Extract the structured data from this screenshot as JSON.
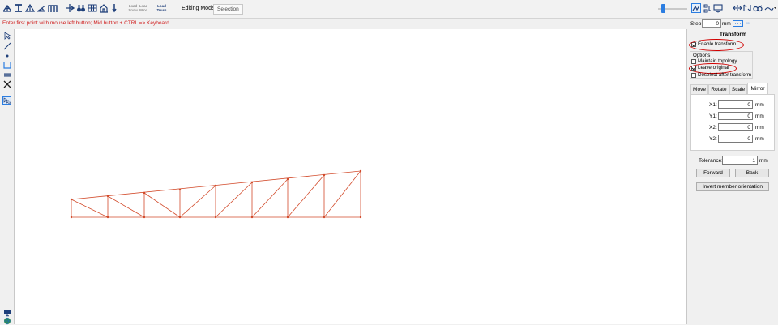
{
  "toolbar": {
    "tool_icons": [
      "truss-tool-icon",
      "i-beam-tool-icon",
      "triangle-tool-icon",
      "fan-truss-tool-icon",
      "portal-frame-tool-icon",
      "node-arrow-tool-icon",
      "binoculars-tool-icon",
      "grid-tool-icon",
      "building-tool-icon",
      "load-arrow-tool-icon"
    ],
    "load_buttons": [
      {
        "line1": "Load",
        "line2": "Snow"
      },
      {
        "line1": "Load",
        "line2": "Wind"
      },
      {
        "line1": "Load",
        "line2": "Truss"
      }
    ],
    "editing_mode_label": "Editing Mode:",
    "editing_mode_value": "Selection",
    "right_icons": [
      "view-toggle-icon",
      "settings-tree-icon",
      "dropdown-box-icon",
      "member-arrows-icon",
      "member-orient-icon",
      "glasses-icon",
      "line-style-icon"
    ],
    "accent_color": "#2b7de1"
  },
  "status_text": "Enter first point with mouse left button; Mid button + CTRL => Keyboard.",
  "left_tools": [
    "pointer-icon",
    "line-icon",
    "point-icon",
    "support-icon",
    "spring-icon",
    "delete-icon",
    "select-transform-icon"
  ],
  "bottom_left_icons": [
    "monitor-icon",
    "globe-icon"
  ],
  "truss_color": "#d24a2a",
  "right_panel": {
    "step_label": "Step:",
    "step_value": "0",
    "step_unit": "mm",
    "title": "Transform",
    "enable_transform": {
      "label": "Enable transform",
      "checked": true
    },
    "options_label": "Options",
    "maintain_topology": {
      "label": "Maintain topology",
      "checked": false
    },
    "leave_original": {
      "label": "Leave original",
      "checked": true
    },
    "deselect_after": {
      "label": "Deselect after transform",
      "checked": false
    },
    "tabs": [
      "Move",
      "Rotate",
      "Scale",
      "Mirror"
    ],
    "active_tab": "Mirror",
    "coords": [
      {
        "label": "X1:",
        "value": "0",
        "unit": "mm"
      },
      {
        "label": "Y1:",
        "value": "0",
        "unit": "mm"
      },
      {
        "label": "X2:",
        "value": "0",
        "unit": "mm"
      },
      {
        "label": "Y2:",
        "value": "0",
        "unit": "mm"
      }
    ],
    "tolerance_label": "Tolerance:",
    "tolerance_value": "1",
    "tolerance_unit": "mm",
    "forward_label": "Forward",
    "back_label": "Back",
    "invert_label": "Invert member orientation"
  }
}
